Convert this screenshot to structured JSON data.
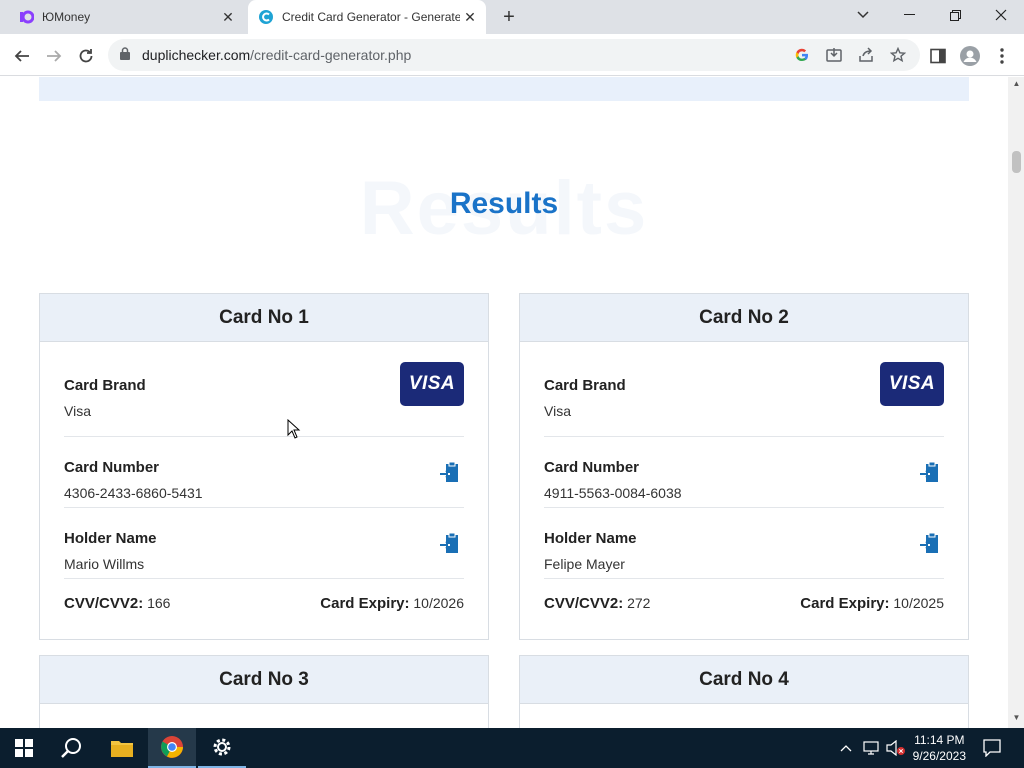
{
  "browser": {
    "tabs": [
      {
        "title": "ЮMoney",
        "active": false
      },
      {
        "title": "Credit Card Generator - Generate",
        "active": true
      }
    ],
    "url_domain": "duplichecker.com",
    "url_path": "/credit-card-generator.php"
  },
  "page": {
    "results_ghost": "Results",
    "results_title": "Results",
    "cards": [
      {
        "header": "Card No 1",
        "brand_label": "Card Brand",
        "brand_value": "Visa",
        "brand_logo": "VISA",
        "number_label": "Card Number",
        "number_value": "4306-2433-6860-5431",
        "holder_label": "Holder Name",
        "holder_value": "Mario Willms",
        "cvv_label": "CVV/CVV2:",
        "cvv_value": "166",
        "expiry_label": "Card Expiry:",
        "expiry_value": "10/2026"
      },
      {
        "header": "Card No 2",
        "brand_label": "Card Brand",
        "brand_value": "Visa",
        "brand_logo": "VISA",
        "number_label": "Card Number",
        "number_value": "4911-5563-0084-6038",
        "holder_label": "Holder Name",
        "holder_value": "Felipe Mayer",
        "cvv_label": "CVV/CVV2:",
        "cvv_value": "272",
        "expiry_label": "Card Expiry:",
        "expiry_value": "10/2025"
      },
      {
        "header": "Card No 3"
      },
      {
        "header": "Card No 4"
      }
    ]
  },
  "taskbar": {
    "time": "11:14 PM",
    "date": "9/26/2023"
  },
  "colors": {
    "accent": "#1a73c8",
    "visa_bg": "#1b2a78",
    "copy_icon": "#1a6fb5",
    "card_header_bg": "#eaf0f8",
    "taskbar_bg": "#0b1e2e"
  }
}
